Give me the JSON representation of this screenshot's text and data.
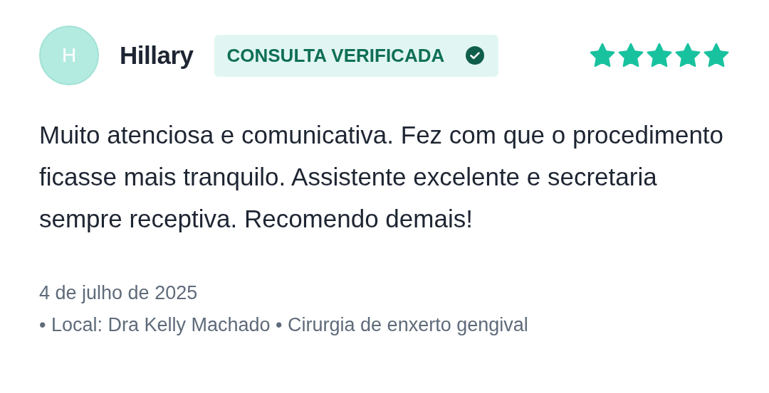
{
  "review": {
    "avatar_initial": "H",
    "author": "Hillary",
    "badge": "CONSULTA VERIFICADA",
    "verified": true,
    "stars": 5,
    "text": "Muito atenciosa e comunicativa. Fez com que o procedimento ficasse mais tranquilo. Assistente excelente e secretaria sempre receptiva. Recomendo demais!",
    "date": "4 de julho de 2025",
    "details": "• Local: Dra Kelly Machado • Cirurgia de enxerto gengival"
  }
}
